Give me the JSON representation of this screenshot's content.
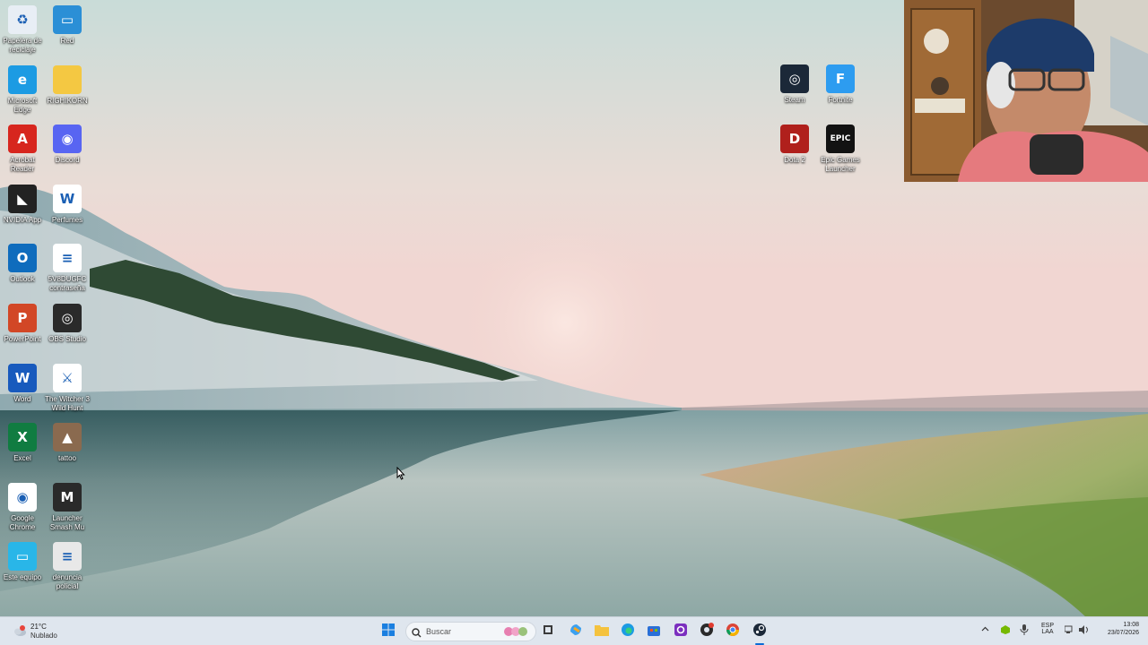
{
  "desktop": {
    "icons_left": [
      {
        "label": "Papelera de reciclaje",
        "icon": "recycle-bin-icon",
        "color": "#e8eef5"
      },
      {
        "label": "Red",
        "icon": "network-icon",
        "color": "#2b8fd6"
      },
      {
        "label": "Microsoft Edge",
        "icon": "edge-icon",
        "color": "#1c9be3"
      },
      {
        "label": "RIGHIKORN",
        "icon": "folder-icon",
        "color": "#f4c842"
      },
      {
        "label": "Acrobat Reader",
        "icon": "acrobat-icon",
        "color": "#d7261e"
      },
      {
        "label": "Discord",
        "icon": "discord-icon",
        "color": "#5865f2"
      },
      {
        "label": "NVIDIA App",
        "icon": "nvidia-icon",
        "color": "#222222"
      },
      {
        "label": "Perfumes",
        "icon": "word-document-icon",
        "color": "#ffffff"
      },
      {
        "label": "Outlook",
        "icon": "outlook-icon",
        "color": "#0f6cbd"
      },
      {
        "label": "5V8DUGFC contraseña",
        "icon": "text-file-icon",
        "color": "#ffffff"
      },
      {
        "label": "PowerPoint",
        "icon": "powerpoint-icon",
        "color": "#d24726"
      },
      {
        "label": "OBS Studio",
        "icon": "obs-icon",
        "color": "#2a2a2a"
      },
      {
        "label": "Word",
        "icon": "word-icon",
        "color": "#185abd"
      },
      {
        "label": "The Witcher 3 Wild Hunt",
        "icon": "witcher-icon",
        "color": "#ffffff"
      },
      {
        "label": "Excel",
        "icon": "excel-icon",
        "color": "#107c41"
      },
      {
        "label": "tattoo",
        "icon": "image-file-icon",
        "color": "#8a6a4f"
      },
      {
        "label": "Google Chrome",
        "icon": "chrome-icon",
        "color": "#ffffff"
      },
      {
        "label": "Launcher Smash Mu",
        "icon": "smash-mu-icon",
        "color": "#2a2a2a"
      },
      {
        "label": "Este equipo",
        "icon": "computer-icon",
        "color": "#29b6e8"
      },
      {
        "label": "denuncia policial",
        "icon": "document-scan-icon",
        "color": "#e8e8e8"
      }
    ],
    "icons_right": [
      {
        "label": "Steam",
        "icon": "steam-icon",
        "color": "#1b2838"
      },
      {
        "label": "Fortnite",
        "icon": "fortnite-icon",
        "color": "#2d9cf0"
      },
      {
        "label": "Dota 2",
        "icon": "dota2-icon",
        "color": "#b0201c"
      },
      {
        "label": "Epic Games Launcher",
        "icon": "epic-games-icon",
        "color": "#121212"
      }
    ]
  },
  "taskbar": {
    "weather": {
      "temp": "21°C",
      "condition": "Nublado"
    },
    "search_placeholder": "Buscar",
    "pinned": [
      {
        "name": "start-button",
        "icon": "windows-icon"
      },
      {
        "name": "task-view-button",
        "icon": "task-view-icon"
      },
      {
        "name": "copilot-button",
        "icon": "copilot-icon"
      },
      {
        "name": "file-explorer-button",
        "icon": "folder-icon"
      },
      {
        "name": "edge-button",
        "icon": "edge-icon"
      },
      {
        "name": "store-button",
        "icon": "store-icon"
      },
      {
        "name": "app-button",
        "icon": "purple-app-icon"
      },
      {
        "name": "obs-button",
        "icon": "obs-icon"
      },
      {
        "name": "chrome-button",
        "icon": "chrome-icon"
      },
      {
        "name": "steam-button",
        "icon": "steam-icon"
      }
    ],
    "tray": {
      "language": "ESP",
      "layout": "LAA",
      "time": "13:08",
      "date": "23/07/2026"
    }
  },
  "colors": {
    "taskbar": "#dfe6ee",
    "accent": "#0a6cd6"
  }
}
